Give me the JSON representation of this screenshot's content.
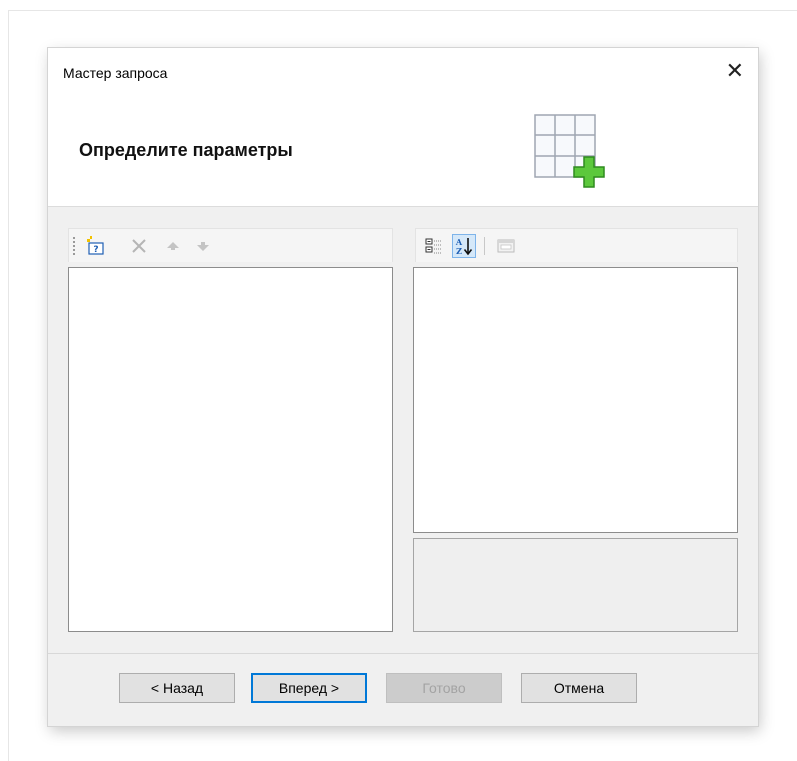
{
  "dialog": {
    "title": "Мастер запроса",
    "close_glyph": "✕",
    "heading": "Определите параметры",
    "header_icon": "table-add-icon"
  },
  "left_toolbar": {
    "items": [
      {
        "name": "new-parameter-icon",
        "enabled": true
      },
      {
        "name": "delete-icon",
        "enabled": false
      },
      {
        "name": "move-up-icon",
        "enabled": false
      },
      {
        "name": "move-down-icon",
        "enabled": false
      }
    ]
  },
  "right_toolbar": {
    "items": [
      {
        "name": "categorized-view-icon",
        "enabled": true
      },
      {
        "name": "sort-alphabetical-icon",
        "enabled": true,
        "pressed": true
      },
      {
        "name": "property-pages-icon",
        "enabled": false
      }
    ]
  },
  "buttons": {
    "back": "< Назад",
    "next": "Вперед >",
    "finish": "Готово",
    "cancel": "Отмена"
  },
  "colors": {
    "dialog_bg": "#f0f0f0",
    "header_bg": "#ffffff",
    "focus_border": "#0078d7",
    "disabled_text": "#a3a3a3",
    "plus_green": "#5cc83c"
  }
}
